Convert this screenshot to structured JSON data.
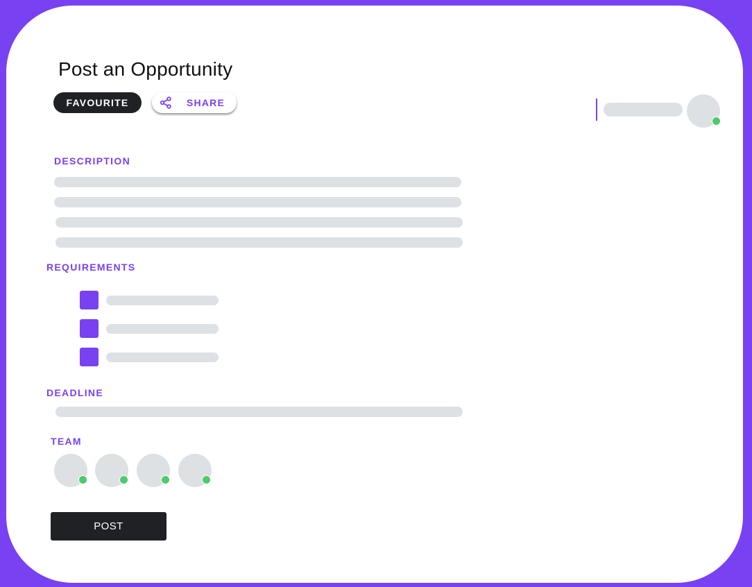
{
  "theme": {
    "accent": "#7841f2",
    "dark": "#1f2124",
    "skeleton": "#dde1e4",
    "online": "#4fca6a"
  },
  "header": {
    "title": "Post an Opportunity",
    "favourite_label": "FAVOURITE",
    "share_label": "SHARE",
    "share_icon": "share-icon"
  },
  "sections": {
    "description": "DESCRIPTION",
    "requirements": "REQUIREMENTS",
    "deadline": "DEADLINE",
    "team": "TEAM"
  },
  "requirements": {
    "count": 3
  },
  "team": {
    "member_count": 4,
    "status": "online"
  },
  "user": {
    "status": "online"
  },
  "footer": {
    "post_label": "POST"
  }
}
